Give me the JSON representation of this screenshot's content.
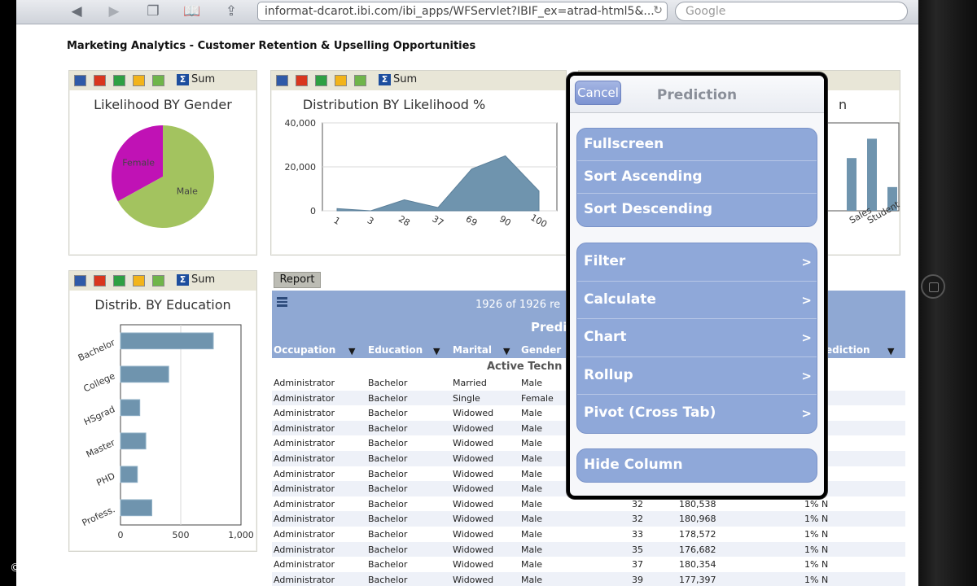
{
  "browser": {
    "url": "informat-dcarot.ibi.com/ibi_apps/WFServlet?IBIF_ex=atrad-html5&...",
    "search_placeholder": "Google"
  },
  "page": {
    "title": "Marketing Analytics - Customer Retention & Upselling Opportunities"
  },
  "toolbar": {
    "sum_label": "Sum"
  },
  "charts": {
    "gender": {
      "title": "Likelihood BY Gender",
      "chart_data": {
        "type": "pie",
        "categories": [
          "Female",
          "Male"
        ],
        "values": [
          33,
          67
        ],
        "colors": [
          "#c012b5",
          "#a3c35f"
        ]
      }
    },
    "likelihood": {
      "title": "Distribution BY Likelihood %",
      "chart_data": {
        "type": "area",
        "x": [
          "1",
          "3",
          "28",
          "37",
          "69",
          "90",
          "100"
        ],
        "values": [
          1000,
          0,
          5000,
          1500,
          19000,
          25000,
          9000
        ],
        "ylim": [
          0,
          40000
        ],
        "yticks": [
          "40,000",
          "20,000",
          "0"
        ],
        "color": "#6f94ae"
      }
    },
    "education": {
      "title": "Distrib. BY Education",
      "chart_data": {
        "type": "bar",
        "orientation": "horizontal",
        "categories": [
          "Bachelor",
          "College",
          "HSgrad",
          "Master",
          "PHD",
          "Profess."
        ],
        "values": [
          770,
          400,
          160,
          210,
          140,
          260
        ],
        "xlim": [
          0,
          1000
        ],
        "xticks": [
          "0",
          "500",
          "1,000"
        ],
        "color": "#6f94ae"
      }
    },
    "occupation_partial": {
      "title_fragment": "n",
      "x_labels_fragment": [
        "Sales",
        "Student"
      ],
      "values_fragment": [
        0.6,
        0.82,
        0.27
      ],
      "color": "#6f94ae"
    }
  },
  "report": {
    "tab_label": "Report",
    "count_text": "1926 of 1926 re",
    "prediction_header": "Predic",
    "columns": [
      "Occupation",
      "Education",
      "Marital",
      "Gender",
      "ediction"
    ],
    "group_label": "Active Techn",
    "rows": [
      [
        "Administrator",
        "Bachelor",
        "Married",
        "Male",
        "",
        "",
        ""
      ],
      [
        "Administrator",
        "Bachelor",
        "Single",
        "Female",
        "",
        "",
        ""
      ],
      [
        "Administrator",
        "Bachelor",
        "Widowed",
        "Male",
        "",
        "",
        ""
      ],
      [
        "Administrator",
        "Bachelor",
        "Widowed",
        "Male",
        "",
        "",
        ""
      ],
      [
        "Administrator",
        "Bachelor",
        "Widowed",
        "Male",
        "",
        "",
        ""
      ],
      [
        "Administrator",
        "Bachelor",
        "Widowed",
        "Male",
        "",
        "",
        ""
      ],
      [
        "Administrator",
        "Bachelor",
        "Widowed",
        "Male",
        "",
        "",
        ""
      ],
      [
        "Administrator",
        "Bachelor",
        "Widowed",
        "Male",
        "",
        "",
        ""
      ],
      [
        "Administrator",
        "Bachelor",
        "Widowed",
        "Male",
        "32",
        "180,538",
        "1% N"
      ],
      [
        "Administrator",
        "Bachelor",
        "Widowed",
        "Male",
        "32",
        "180,968",
        "1% N"
      ],
      [
        "Administrator",
        "Bachelor",
        "Widowed",
        "Male",
        "33",
        "178,572",
        "1% N"
      ],
      [
        "Administrator",
        "Bachelor",
        "Widowed",
        "Male",
        "35",
        "176,682",
        "1% N"
      ],
      [
        "Administrator",
        "Bachelor",
        "Widowed",
        "Male",
        "37",
        "180,354",
        "1% N"
      ],
      [
        "Administrator",
        "Bachelor",
        "Widowed",
        "Male",
        "39",
        "177,397",
        "1% N"
      ]
    ]
  },
  "popup": {
    "cancel_label": "Cancel",
    "title": "Prediction",
    "group1": [
      "Fullscreen",
      "Sort Ascending",
      "Sort Descending"
    ],
    "group2": [
      "Filter",
      "Calculate",
      "Chart",
      "Rollup",
      "Pivot (Cross Tab)"
    ],
    "group3": [
      "Hide Column"
    ],
    "chevron": ">"
  },
  "copyright": "©"
}
